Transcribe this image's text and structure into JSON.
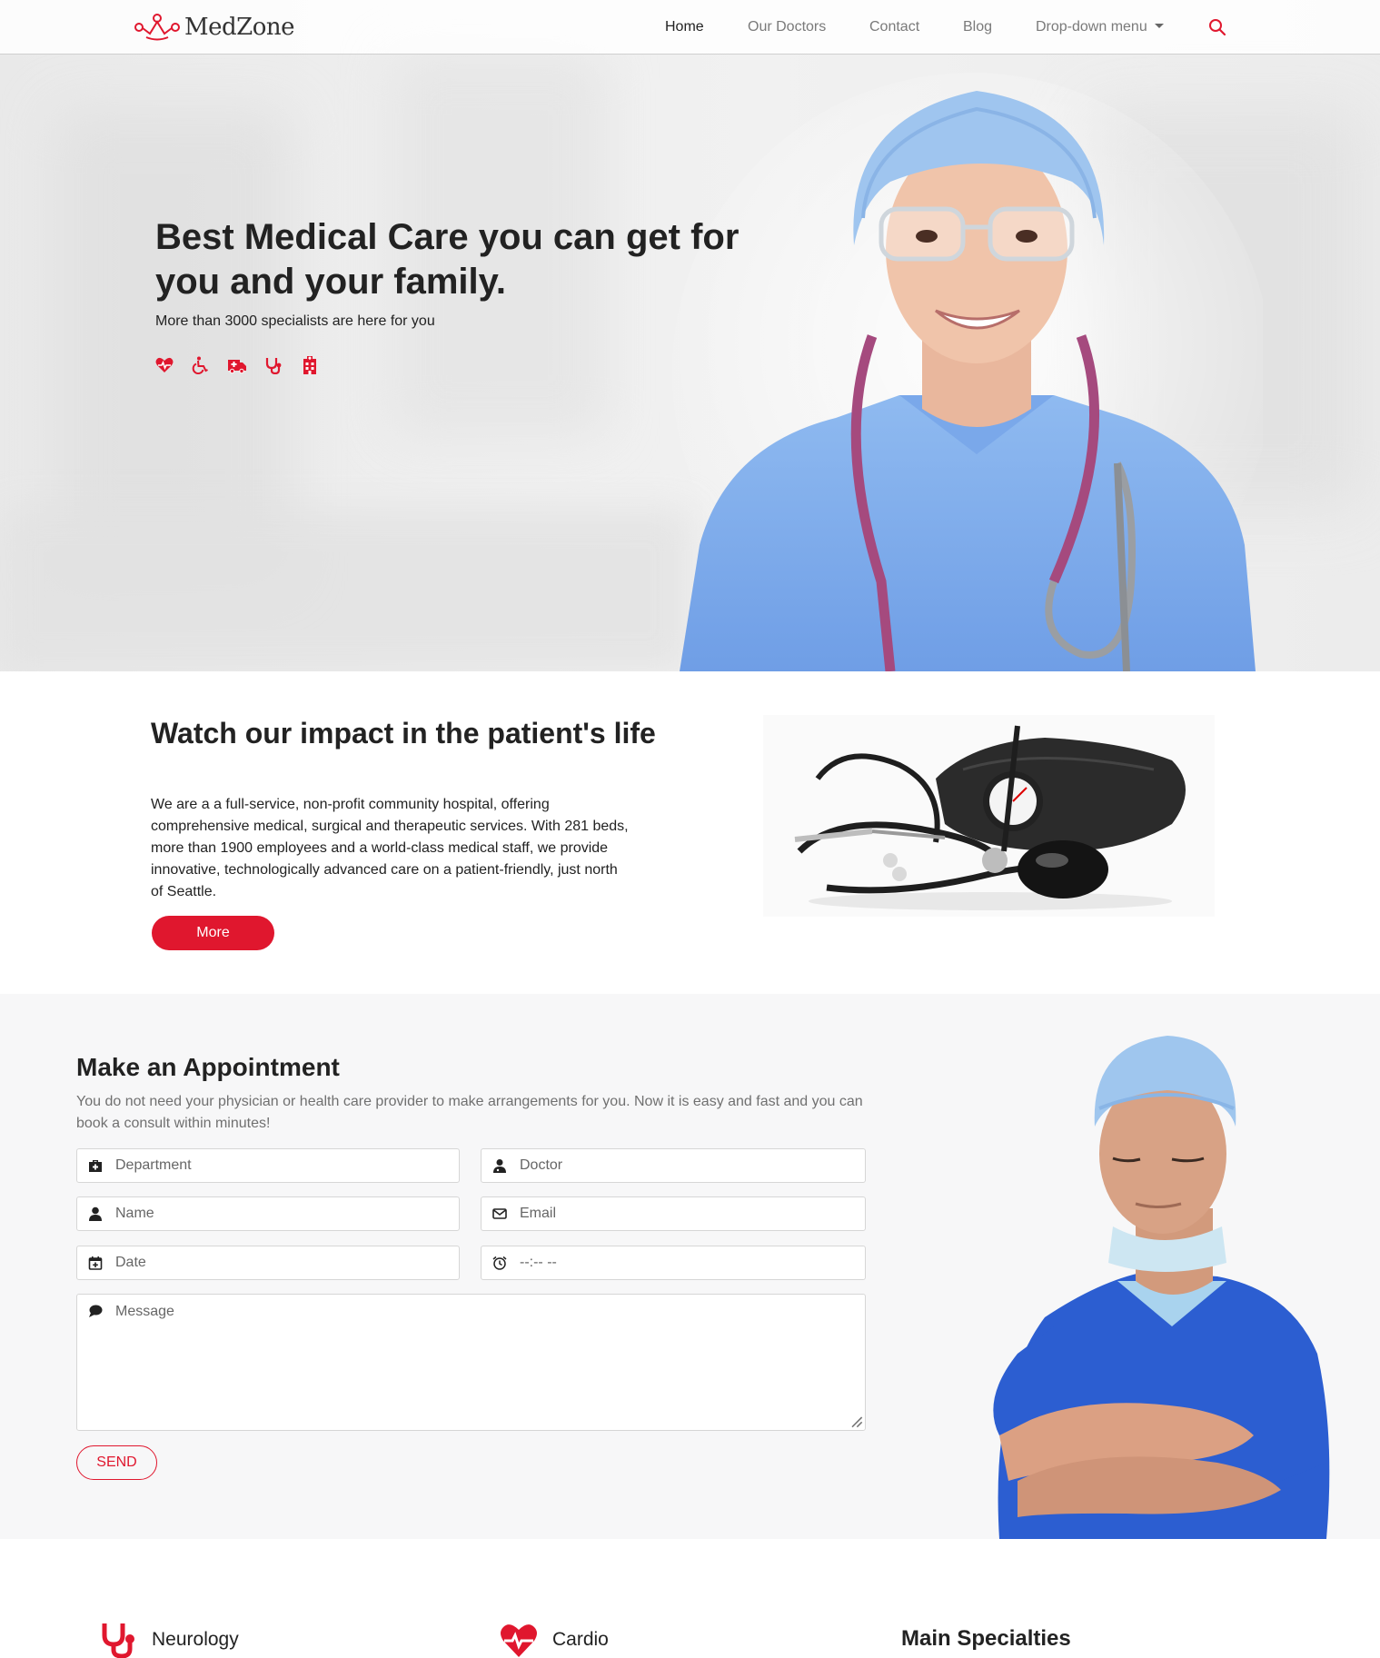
{
  "brand": {
    "name": "MedZone",
    "accent": "#e0172e"
  },
  "nav": {
    "items": [
      {
        "label": "Home",
        "active": true
      },
      {
        "label": "Our Doctors",
        "active": false
      },
      {
        "label": "Contact",
        "active": false
      },
      {
        "label": "Blog",
        "active": false
      },
      {
        "label": "Drop-down menu",
        "active": false,
        "has_caret": true
      }
    ],
    "search_icon": "search-icon"
  },
  "hero": {
    "title": "Best Medical Care you can get for you and your family.",
    "subtitle": "More than 3000 specialists are here for you",
    "icons": [
      "heartbeat-icon",
      "wheelchair-icon",
      "ambulance-icon",
      "stethoscope-icon",
      "hospital-icon"
    ]
  },
  "impact": {
    "title": "Watch our impact in the patient's life",
    "text": "We are a a full-service, non-profit community hospital, offering comprehensive medical, surgical and therapeutic services. With 281 beds, more than 1900 employees and a world-class medical staff, we provide innovative, technologically advanced care on a patient-friendly, just north of Seattle.",
    "button": "More"
  },
  "appointment": {
    "title": "Make an Appointment",
    "text": "You do not need your physician or health care provider to make arrangements for you. Now it is easy and fast and you can book a consult within minutes!",
    "fields": {
      "department": "Department",
      "doctor": "Doctor",
      "name": "Name",
      "email": "Email",
      "date": "Date",
      "time": "--:-- --",
      "message": "Message"
    },
    "send": "SEND"
  },
  "specialties": {
    "items": [
      {
        "label": "Neurology",
        "icon": "stethoscope-icon"
      },
      {
        "label": "Cardio",
        "icon": "heartbeat-icon"
      }
    ],
    "heading": "Main Specialties"
  }
}
